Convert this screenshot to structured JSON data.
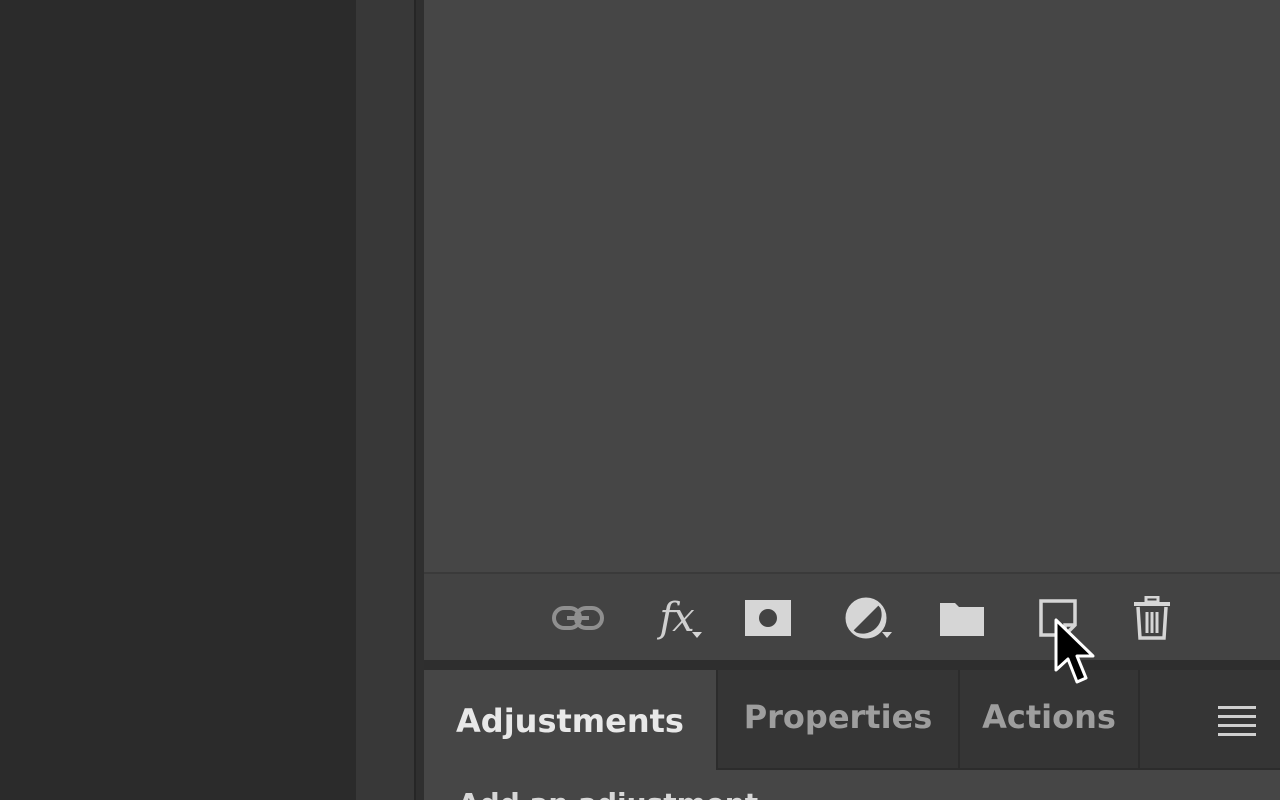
{
  "layers_footer": {
    "buttons": [
      {
        "name": "link-layers",
        "icon": "link-icon"
      },
      {
        "name": "layer-style",
        "icon": "fx-icon",
        "label": "fx",
        "has_dropdown": true
      },
      {
        "name": "add-mask",
        "icon": "mask-icon"
      },
      {
        "name": "new-adjustment",
        "icon": "adjustment-circle-icon",
        "has_dropdown": true
      },
      {
        "name": "new-group",
        "icon": "folder-icon"
      },
      {
        "name": "new-layer",
        "icon": "new-layer-icon"
      },
      {
        "name": "delete-layer",
        "icon": "trash-icon"
      }
    ]
  },
  "bottom_panel": {
    "tabs": [
      {
        "label": "Adjustments",
        "active": true
      },
      {
        "label": "Properties",
        "active": false
      },
      {
        "label": "Actions",
        "active": false
      }
    ],
    "subtitle": "Add an adjustment",
    "menu_icon": "panel-menu-icon"
  },
  "colors": {
    "canvas_bg": "#2b2b2b",
    "panel_bg": "#464646",
    "inactive_tab_bg": "#353535",
    "icon_fg": "#cfcfcf"
  }
}
